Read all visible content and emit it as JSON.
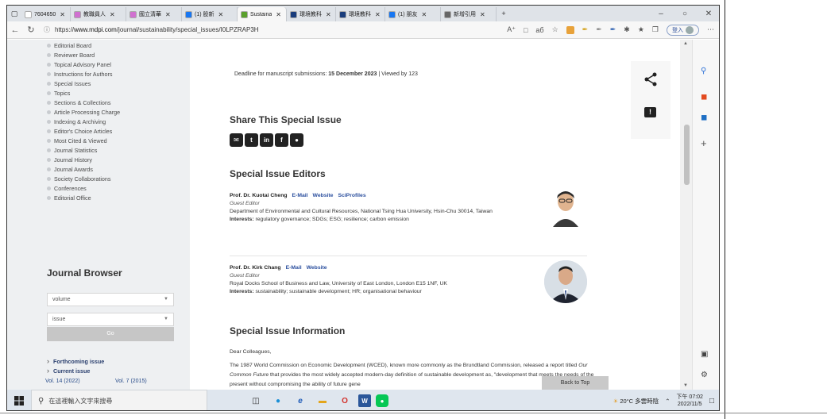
{
  "browser": {
    "tabs": [
      {
        "label": "7604650",
        "fav": "#ffffff",
        "active": false
      },
      {
        "label": "教職員人",
        "fav": "#d070d0",
        "active": false
      },
      {
        "label": "國立清華",
        "fav": "#d070d0",
        "active": false
      },
      {
        "label": "(1) 股新",
        "fav": "#1877f2",
        "active": false
      },
      {
        "label": "Sustaina",
        "fav": "#5aa02c",
        "active": true
      },
      {
        "label": "環境教科",
        "fav": "#1a3d7c",
        "active": false
      },
      {
        "label": "環境教科",
        "fav": "#1a3d7c",
        "active": false
      },
      {
        "label": "(1) 朋友",
        "fav": "#1877f2",
        "active": false
      },
      {
        "label": "新增引用",
        "fav": "#666666",
        "active": false
      }
    ],
    "new_tab": "+",
    "url_prefix": "https://",
    "url_host": "www.mdpi.com",
    "url_path": "/journal/sustainability/special_issues/I0LPZRAP3H",
    "login_label": "登入"
  },
  "sidebar": {
    "items": [
      "Editorial Board",
      "Reviewer Board",
      "Topical Advisory Panel",
      "Instructions for Authors",
      "Special Issues",
      "Topics",
      "Sections & Collections",
      "Article Processing Charge",
      "Indexing & Archiving",
      "Editor's Choice Articles",
      "Most Cited & Viewed",
      "Journal Statistics",
      "Journal History",
      "Journal Awards",
      "Society Collaborations",
      "Conferences",
      "Editorial Office"
    ],
    "journal_browser_title": "Journal Browser",
    "volume_placeholder": "volume",
    "issue_placeholder": "issue",
    "go_label": "Go",
    "forthcoming_label": "Forthcoming issue",
    "current_label": "Current issue",
    "vol_left": "Vol. 14 (2022)",
    "vol_right": "Vol. 7 (2015)"
  },
  "main": {
    "deadline_prefix": "Deadline for manuscript submissions: ",
    "deadline_date": "15 December 2023",
    "deadline_suffix": " | Viewed by 123",
    "share_title": "Share This Special Issue",
    "editors_title": "Special Issue Editors",
    "editors": [
      {
        "name": "Prof. Dr. Kuotai Cheng",
        "links": [
          "E-Mail",
          "Website",
          "SciProfiles"
        ],
        "role": "Guest Editor",
        "affiliation": "Department of Environmental and Cultural Resources, National Tsing Hua University, Hsin-Chu 30014, Taiwan",
        "interests_label": "Interests:",
        "interests": " regulatory governance; SDGs; ESG; resilience; carbon emission"
      },
      {
        "name": "Prof. Dr. Kirk Chang",
        "links": [
          "E-Mail",
          "Website"
        ],
        "role": "Guest Editor",
        "affiliation": "Royal Docks School of Business and Law, University of East London, London E15 1NF, UK",
        "interests_label": "Interests:",
        "interests": " sustainability; sustainable development; HR; organisational behaviour"
      }
    ],
    "info_title": "Special Issue Information",
    "greeting": "Dear Colleagues,",
    "body_1": "The 1987 World Commission on Economic Development (WCED), known more commonly as the Brundtland Commission, released a report titled ",
    "body_italic": "Our Common Future",
    "body_2": " that provides the most widely accepted modern-day definition of sustainable development as, \"development that meets the needs of the present without compromising the ability of future gene",
    "back_to_top": "Back to Top"
  },
  "taskbar": {
    "search_placeholder": "在這裡輸入文字來搜尋",
    "weather": "20°C  多雲時陰",
    "time": "下午 07:02",
    "date": "2022/11/5"
  }
}
